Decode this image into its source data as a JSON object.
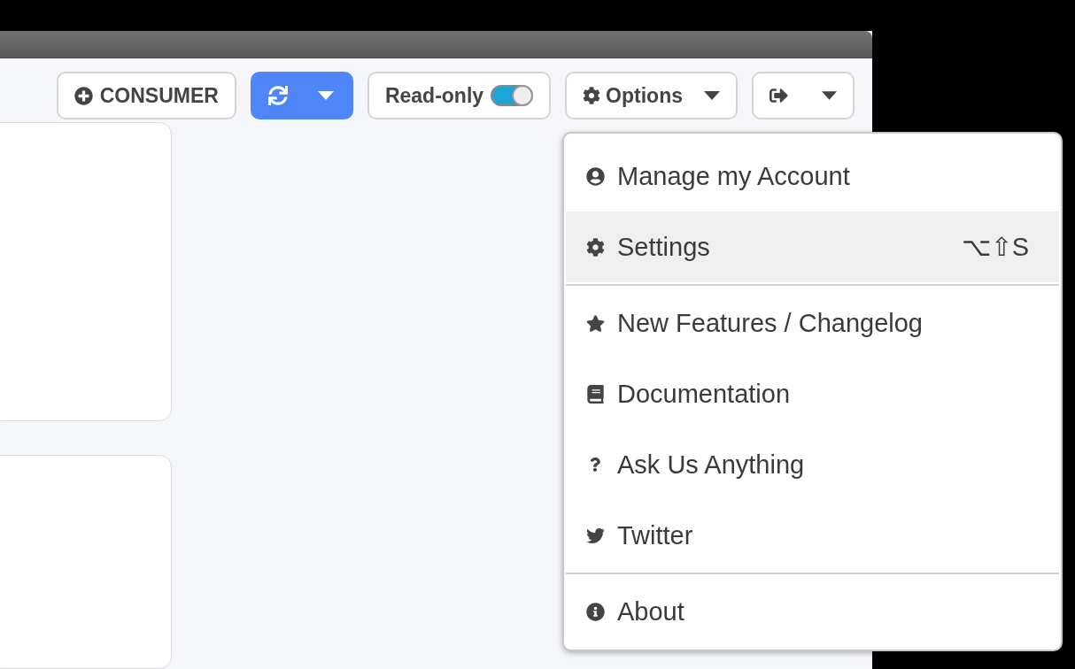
{
  "toolbar": {
    "consumer_button": {
      "label": "CONSUMER"
    },
    "read_only": {
      "label": "Read-only",
      "on": true
    },
    "options_button": {
      "label": "Options"
    }
  },
  "menu": [
    {
      "kind": "item",
      "label": "Manage my Account",
      "selected": false
    },
    {
      "kind": "item",
      "label": "Settings",
      "shortcut": "⌥⇧S",
      "selected": true
    },
    {
      "kind": "divider"
    },
    {
      "kind": "item",
      "label": "New Features / Changelog",
      "selected": false
    },
    {
      "kind": "item",
      "label": "Documentation",
      "selected": false
    },
    {
      "kind": "item",
      "label": "Ask Us Anything",
      "selected": false
    },
    {
      "kind": "item",
      "label": "Twitter",
      "selected": false
    },
    {
      "kind": "divider"
    },
    {
      "kind": "item",
      "label": "About",
      "selected": false
    }
  ]
}
